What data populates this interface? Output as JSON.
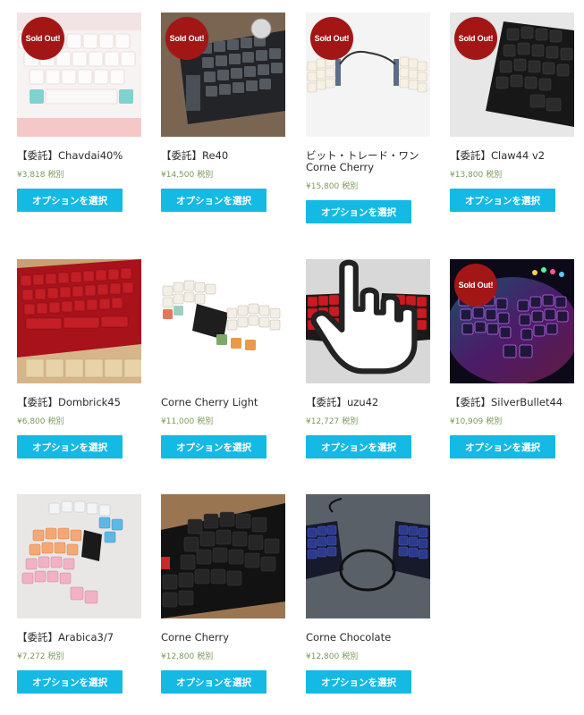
{
  "products": [
    {
      "title": "【委託】Chavdai40%",
      "price": "¥3,818",
      "tax": "税別",
      "button": "オプションを選択",
      "sold_out": "Sold Out!",
      "image_icon": "keyboard-photo"
    },
    {
      "title": "【委託】Re40",
      "price": "¥14,500",
      "tax": "税別",
      "button": "オプションを選択",
      "sold_out": "Sold Out!",
      "image_icon": "keyboard-photo"
    },
    {
      "title": "ビット・トレード・ワン Corne Cherry",
      "price": "¥15,800",
      "tax": "税別",
      "button": "オプションを選択",
      "sold_out": "Sold Out!",
      "image_icon": "keyboard-photo"
    },
    {
      "title": "【委託】Claw44 v2",
      "price": "¥13,800",
      "tax": "税別",
      "button": "オプションを選択",
      "sold_out": "Sold Out!",
      "image_icon": "keyboard-photo"
    },
    {
      "title": "【委託】Dombrick45",
      "price": "¥6,800",
      "tax": "税別",
      "button": "オプションを選択",
      "sold_out": "",
      "image_icon": "keyboard-photo"
    },
    {
      "title": "Corne Cherry Light",
      "price": "¥11,000",
      "tax": "税別",
      "button": "オプションを選択",
      "sold_out": "",
      "image_icon": "keyboard-photo"
    },
    {
      "title": "【委託】uzu42",
      "price": "¥12,727",
      "tax": "税別",
      "button": "オプションを選択",
      "sold_out": "",
      "image_icon": "keyboard-photo"
    },
    {
      "title": "【委託】SilverBullet44",
      "price": "¥10,909",
      "tax": "税別",
      "button": "オプションを選択",
      "sold_out": "Sold Out!",
      "image_icon": "keyboard-photo"
    },
    {
      "title": "【委託】Arabica3/7",
      "price": "¥7,272",
      "tax": "税別",
      "button": "オプションを選択",
      "sold_out": "",
      "image_icon": "keyboard-photo"
    },
    {
      "title": "Corne Cherry",
      "price": "¥12,800",
      "tax": "税別",
      "button": "オプションを選択",
      "sold_out": "",
      "image_icon": "keyboard-photo"
    },
    {
      "title": "Corne Chocolate",
      "price": "¥12,800",
      "tax": "税別",
      "button": "オプションを選択",
      "sold_out": "",
      "image_icon": "keyboard-photo"
    }
  ],
  "colors": {
    "button_bg": "#14b9e4",
    "sold_out_bg": "#a31616",
    "price_text": "#7a9a5a",
    "title_text": "#2c2c2c"
  },
  "cursor_icon": "hand-pointer-icon"
}
